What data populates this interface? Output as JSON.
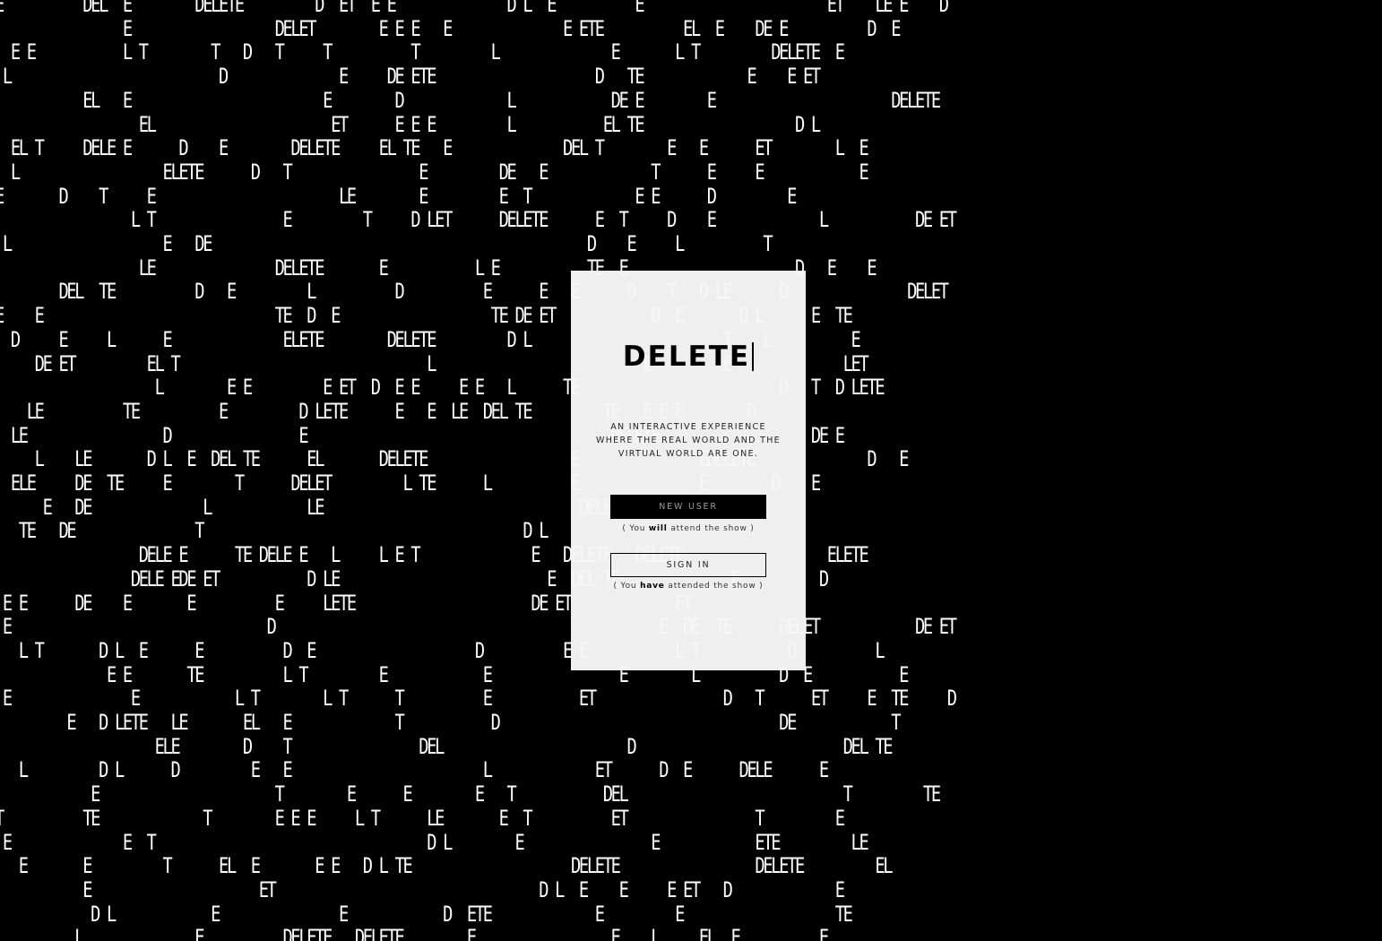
{
  "colors": {
    "background": "#000000",
    "background_text": "#ffffff",
    "modal_background": "#efefef",
    "primary_button": "#000000",
    "primary_button_text": "#9a9a9a",
    "ink": "#000000"
  },
  "background_text_lines": [
    "E          DEL  E        DELETE         D  ET  E E              D L  E          E                       ET    LE E    D",
    "                E                  DELET        E E E   E              E ETE          EL  E    DE E          D  E",
    "  E E           L T        T   D   T     T          T         L              E       L T         DELETE  E",
    " L                          D              E     DE ETE                    D   TE             E    E ET",
    "           EL   E                        E        D             L            DE E        E                      DELETE",
    "                  EL                      ET      E E E         L           EL TE                   D L",
    "  EL T     DELE E      D    E        DELETE     EL TE   E              DEL T        E   E      ET        L  E",
    "  L                  ELETE      D   T                E         DE   E             T      E     E            E",
    "E       D    T     E                       LE        E         E  T             E E      D         E",
    "                 L T                E         T     D LET      DELETE      E  T     D    E             L           DE ET",
    " L                   E   DE                                               D    E     L          T",
    "                  LE               DELETE       E           L E           TE  E                     D   E    E",
    "        DEL  TE          D   E         L          D          E      E   E      D    T   D LE      D               DELET",
    "E    E                             TE  D  E                   TE DE ET            D  E       D L      E  TE",
    "  D     E     L      E              ELETE        DELETE         D L                        T    L          E",
    "     DE ET         EL T                               L                          E         E              LET",
    "                    L        E E         E ET  D  E E     E E   L      TE                         D   T  D LETE",
    "    LE          TE          E         D LETE      E   E  LE  DEL TE         TE   E E E        D",
    "  LE                 D                E                                      DELETE                   DE E",
    "     L    LE       D L  E  DEL TE      EL       DELETE                  E               EDELETE              D   E",
    "  ELE     DE  TE     E        T      DELET         L TE      L          E               E        D    E",
    "      E   DE              L            LE                                DELETE                T",
    "   TE   DE               T                                        D L",
    "                  DELE E      TE DELE E   L     L E T              E   DELETE   DELETE                  ELETE",
    "                 DELE EDE ET           D LE                          E  DEL TE              E          D",
    " E E      DE    E       E          E     LETE                      DE ET             ET",
    " E                                D                                                E  DE  TE      DELET            DE ET",
    "   L T       D L  E      E          D  E                    D          E E           L T           D          L",
    "              E E       TE          L T         E            E                E        L          D  E           E",
    " E               E            L T        L T      T          E           ET                D   T      ET     E  TE     D",
    "         E   D LETE   LE       EL   E             T           D                                   DE            T",
    "                    ELE        D    T                DEL                       D                          DEL TE",
    "   L         D L      D         E   E                        L             ET      D  E      DELE      E",
    "            E                      T        E      E        E   T           DEL                           T         TE",
    "T          TE             T        E E E     L T      LE       E  T          ET                T         E",
    " E              E  T                                  D L        E                E            ETE         LE",
    "   E       E         T      EL  E       E E   D L TE                    DELETE                 DELETE         EL",
    "           E                     ET                                 D L  E    E     E ET   D             E",
    "            D L            E               E            D  ETE             E         E                   TE",
    "          L              E          DELETE   DELETE        E                 E    L     EL  E          E"
  ],
  "modal": {
    "title": "DELETE",
    "tagline": "AN INTERACTIVE EXPERIENCE WHERE THE REAL WORLD AND THE VIRTUAL WORLD ARE ONE.",
    "new_user_label": "NEW USER",
    "new_user_note_pre": "( You ",
    "new_user_note_bold": "will",
    "new_user_note_post": " attend the show )",
    "sign_in_label": "SIGN IN",
    "sign_in_note_pre": "( You ",
    "sign_in_note_bold": "have",
    "sign_in_note_post": " attended the show )"
  }
}
